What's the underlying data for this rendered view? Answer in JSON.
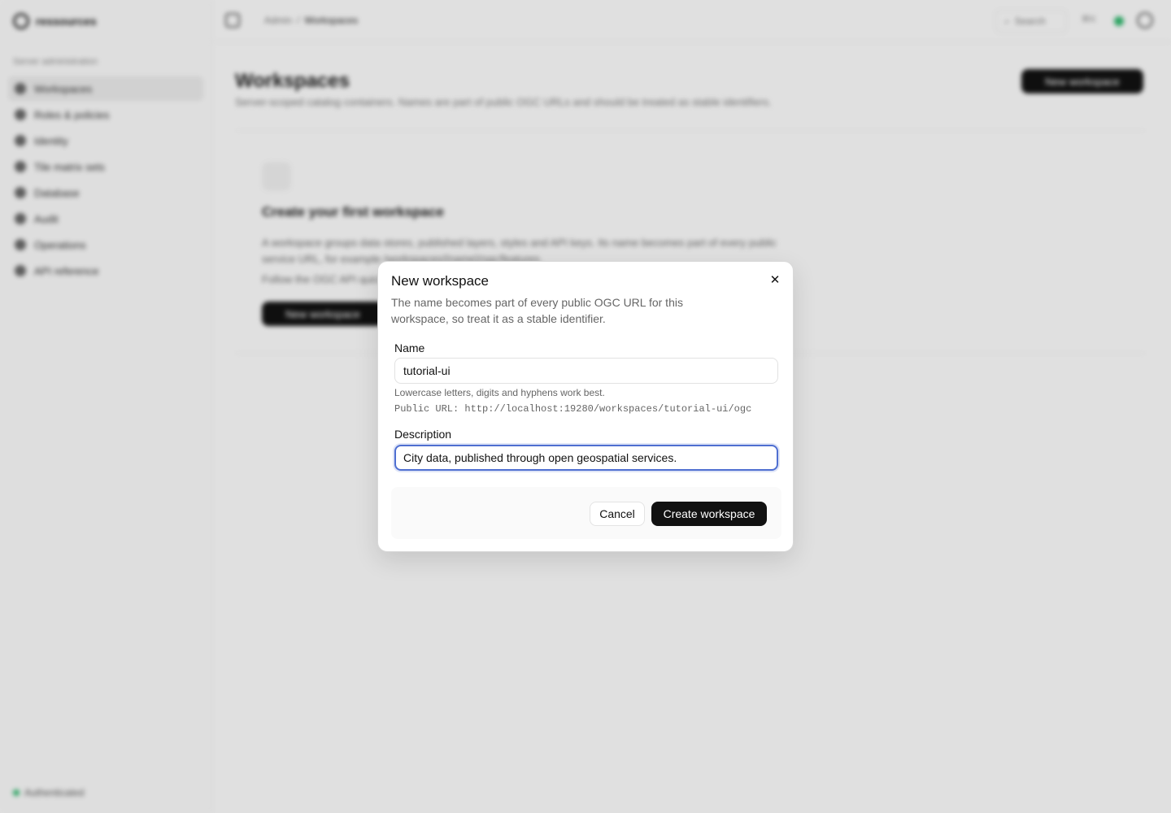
{
  "app": {
    "brand": "ressources",
    "section": "Server administration",
    "nav": [
      "Workspaces",
      "Roles & policies",
      "Identity",
      "Tile matrix sets",
      "Database",
      "Audit",
      "Operations",
      "API reference"
    ],
    "footer_status": "Authenticated"
  },
  "topbar": {
    "breadcrumb_root": "Admin",
    "breadcrumb_current": "Workspaces",
    "search_label": "Search",
    "shortcut": "⌘K"
  },
  "page": {
    "title": "Workspaces",
    "subtitle": "Server-scoped catalog containers. Names are part of public OGC URLs and should be treated as stable identifiers.",
    "new_button": "New workspace",
    "empty": {
      "title": "Create your first workspace",
      "text": "A workspace groups data stores, published layers, styles and API keys. Its name becomes part of every public service URL, for example /workspaces/{name}/ogc/features.",
      "text2": "Follow the OGC API quickstart to get started.",
      "button": "New workspace"
    }
  },
  "modal": {
    "title": "New workspace",
    "description": "The name becomes part of every public OGC URL for this workspace, so treat it as a stable identifier.",
    "name_label": "Name",
    "name_value": "tutorial-ui",
    "name_hint": "Lowercase letters, digits and hyphens work best.",
    "public_url": "Public URL: http://localhost:19280/workspaces/tutorial-ui/ogc",
    "description_label": "Description",
    "description_value": "City data, published through open geospatial services.",
    "cancel_label": "Cancel",
    "create_label": "Create workspace",
    "close_icon": "close-icon"
  },
  "colors": {
    "accent_focus": "#4f6fd1",
    "primary_button": "#111111",
    "status_ok": "#2fb36b"
  }
}
